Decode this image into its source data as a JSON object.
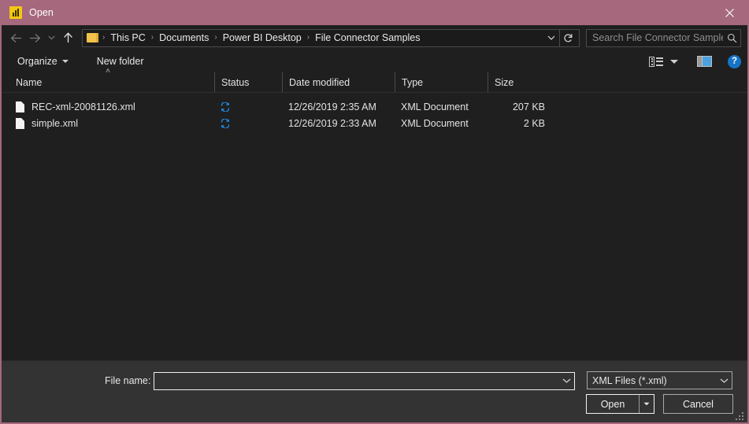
{
  "window": {
    "title": "Open",
    "app_icon": "power-bi-icon",
    "titlebar_color": "#a5687d",
    "close_label": "✕"
  },
  "nav": {
    "back": "←",
    "forward": "→",
    "recent": "⌄",
    "up": "↑",
    "refresh": "↻",
    "dropdown": "⌄"
  },
  "address": {
    "folder_icon": "folder-icon",
    "crumbs": [
      "This PC",
      "Documents",
      "Power BI Desktop",
      "File Connector Samples"
    ],
    "separator": "›"
  },
  "search": {
    "placeholder": "Search File Connector Samples",
    "icon": "search-icon"
  },
  "toolbar": {
    "organize": "Organize",
    "new_folder": "New folder",
    "view_icon": "view-options-icon",
    "preview_pane_icon": "preview-pane-icon",
    "help_icon": "help-icon",
    "help_label": "?"
  },
  "columns": [
    {
      "label": "Name",
      "sorted": true,
      "sort_mark": "˄"
    },
    {
      "label": "Status",
      "sorted": false
    },
    {
      "label": "Date modified",
      "sorted": false
    },
    {
      "label": "Type",
      "sorted": false
    },
    {
      "label": "Size",
      "sorted": false
    }
  ],
  "files": [
    {
      "name": "REC-xml-20081126.xml",
      "status_icon": "sync-pending-icon",
      "date_modified": "12/26/2019 2:35 AM",
      "type": "XML Document",
      "size": "207 KB"
    },
    {
      "name": "simple.xml",
      "status_icon": "sync-pending-icon",
      "date_modified": "12/26/2019 2:33 AM",
      "type": "XML Document",
      "size": "2 KB"
    }
  ],
  "footer": {
    "filename_label": "File name:",
    "filename_value": "",
    "filename_placeholder": "",
    "filename_chevron": "⌄",
    "filter_value": "XML Files (*.xml)",
    "filter_chevron": "⌄",
    "open_label": "Open",
    "open_split_caret": "▼",
    "cancel_label": "Cancel"
  },
  "colors": {
    "accent": "#a5687d",
    "sync_blue": "#1f86e0",
    "help_blue": "#1674c8",
    "folder_yellow": "#f2c14b",
    "powerbi_yellow": "#f2c811"
  }
}
